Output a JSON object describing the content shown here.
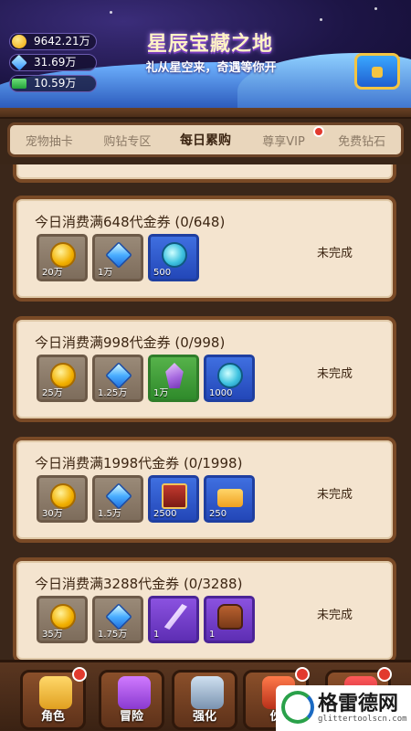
{
  "banner": {
    "title": "星辰宝藏之地",
    "subtitle": "礼从星空来，奇遇等你开"
  },
  "currencies": [
    {
      "icon": "gold-coin-icon",
      "value": "9642.21万"
    },
    {
      "icon": "diamond-icon",
      "value": "31.69万"
    },
    {
      "icon": "cash-icon",
      "value": "10.59万"
    }
  ],
  "tabs": [
    {
      "label": "宠物抽卡",
      "active": false
    },
    {
      "label": "购钻专区",
      "active": false
    },
    {
      "label": "每日累购",
      "active": true
    },
    {
      "label": "尊享VIP",
      "active": false,
      "badge": true
    },
    {
      "label": "免费钻石",
      "active": false
    }
  ],
  "cards": [
    {
      "title": "今日消费满648代金券 (0/648)",
      "status": "未完成",
      "rewards": [
        {
          "icon": "gold-coin-icon",
          "qty": "20万",
          "rarity": "gray"
        },
        {
          "icon": "diamond-icon",
          "qty": "1万",
          "rarity": "gray"
        },
        {
          "icon": "orb-icon",
          "qty": "500",
          "rarity": "blue"
        }
      ]
    },
    {
      "title": "今日消费满998代金券 (0/998)",
      "status": "未完成",
      "rewards": [
        {
          "icon": "gold-coin-icon",
          "qty": "25万",
          "rarity": "gray"
        },
        {
          "icon": "diamond-icon",
          "qty": "1.25万",
          "rarity": "gray"
        },
        {
          "icon": "crystal-icon",
          "qty": "1万",
          "rarity": "green"
        },
        {
          "icon": "orb-icon",
          "qty": "1000",
          "rarity": "blue"
        }
      ]
    },
    {
      "title": "今日消费满1998代金券 (0/1998)",
      "status": "未完成",
      "rewards": [
        {
          "icon": "gold-coin-icon",
          "qty": "30万",
          "rarity": "gray"
        },
        {
          "icon": "diamond-icon",
          "qty": "1.5万",
          "rarity": "gray"
        },
        {
          "icon": "book-icon",
          "qty": "2500",
          "rarity": "blue"
        },
        {
          "icon": "ticket-icon",
          "qty": "250",
          "rarity": "blue"
        }
      ]
    },
    {
      "title": "今日消费满3288代金券 (0/3288)",
      "status": "未完成",
      "rewards": [
        {
          "icon": "gold-coin-icon",
          "qty": "35万",
          "rarity": "gray"
        },
        {
          "icon": "diamond-icon",
          "qty": "1.75万",
          "rarity": "gray"
        },
        {
          "icon": "feather-icon",
          "qty": "1",
          "rarity": "purple"
        },
        {
          "icon": "backpack-icon",
          "qty": "1",
          "rarity": "purple"
        }
      ]
    }
  ],
  "bottom_nav": [
    {
      "label": "角色",
      "icon": "character-icon",
      "badge": true
    },
    {
      "label": "冒险",
      "icon": "portal-icon",
      "badge": false
    },
    {
      "label": "强化",
      "icon": "anvil-icon",
      "badge": false
    },
    {
      "label": "伙",
      "icon": "pet-icon",
      "badge": true
    },
    {
      "label": "",
      "icon": "gift-icon",
      "badge": true
    }
  ],
  "watermark": {
    "name": "格雷德网",
    "url": "glittertoolscn.com"
  },
  "colors": {
    "card_bg": "#f4e4cf",
    "card_border": "#7a4a26",
    "badge_red": "#e23a2e"
  }
}
